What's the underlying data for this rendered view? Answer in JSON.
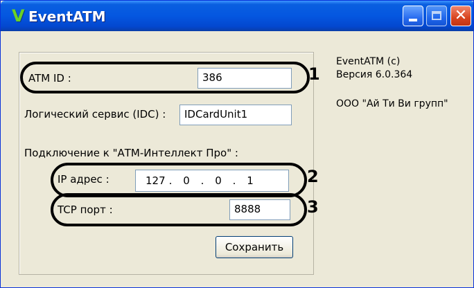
{
  "window": {
    "title": "EventATM",
    "icon_glyph": "V"
  },
  "titlebar_buttons": {
    "minimize": "minimize-icon",
    "maximize": "maximize-icon",
    "close_glyph": "✕"
  },
  "form": {
    "atm_id_label": "ATM ID :",
    "atm_id_value": "386",
    "logical_service_label": "Логический сервис (IDC) :",
    "logical_service_value": "IDCardUnit1",
    "connection_heading": "Подключение к \"АТМ-Интеллект Про\" :",
    "ip_label": "IP адрес :",
    "ip_octets": [
      "127",
      "0",
      "0",
      "1"
    ],
    "ip_separator": ".",
    "tcp_label": "TCP порт :",
    "tcp_value": "8888",
    "save_label": "Сохранить"
  },
  "about": {
    "product": "EventATM (c)",
    "version": "Версия 6.0.364",
    "company": "ООО \"Ай Ти Ви групп\""
  },
  "annotations": [
    "1",
    "2",
    "3"
  ],
  "colors": {
    "titlebar": "#0457e0",
    "window_bg": "#ece9d8",
    "field_border": "#7f9db9",
    "close_button": "#d8451f"
  }
}
